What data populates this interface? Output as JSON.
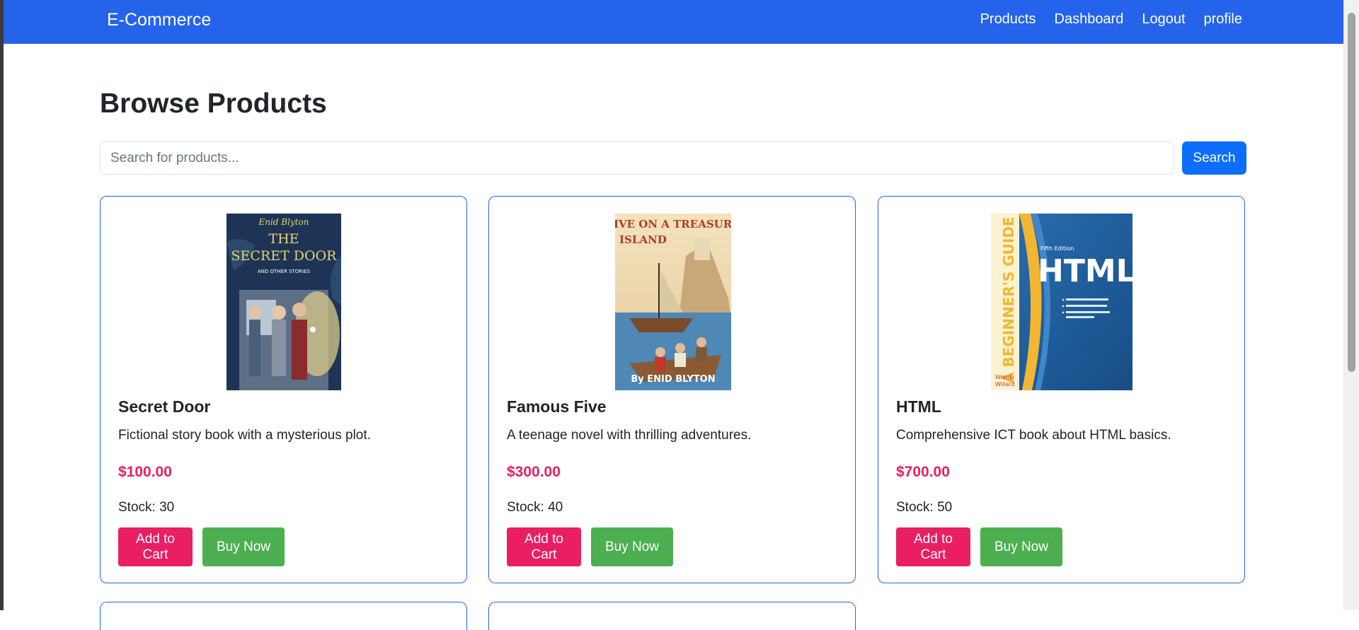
{
  "navbar": {
    "brand": "E-Commerce",
    "links": [
      "Products",
      "Dashboard",
      "Logout",
      "profile"
    ],
    "bg_color": "#2563eb"
  },
  "main": {
    "title": "Browse Products",
    "search": {
      "placeholder": "Search for products...",
      "value": "",
      "button_label": "Search"
    }
  },
  "products": [
    {
      "name": "Secret Door",
      "description": "Fictional story book with a mysterious plot.",
      "price": "$100.00",
      "stock": "Stock: 30",
      "cover_text": [
        "Enid Blyton",
        "THE",
        "SECRET DOOR",
        "AND OTHER STORIES"
      ]
    },
    {
      "name": "Famous Five",
      "description": "A teenage novel with thrilling adventures.",
      "price": "$300.00",
      "stock": "Stock: 40",
      "cover_text": [
        "FIVE ON A TREASURE",
        "ISLAND",
        "By ENID BLYTON"
      ]
    },
    {
      "name": "HTML",
      "description": "Comprehensive ICT book about HTML basics.",
      "price": "$700.00",
      "stock": "Stock: 50",
      "cover_text": [
        "A BEGINNER'S GUIDE",
        "Fifth Edition",
        "HTML",
        "Wendy",
        "Willard"
      ]
    }
  ],
  "buttons": {
    "add_to_cart": "Add to Cart",
    "buy_now": "Buy Now"
  },
  "colors": {
    "price": "#e91e63",
    "add_to_cart": "#e91e63",
    "buy_now": "#4caf50",
    "search_button": "#0d6efd",
    "card_border": "#2563eb"
  }
}
